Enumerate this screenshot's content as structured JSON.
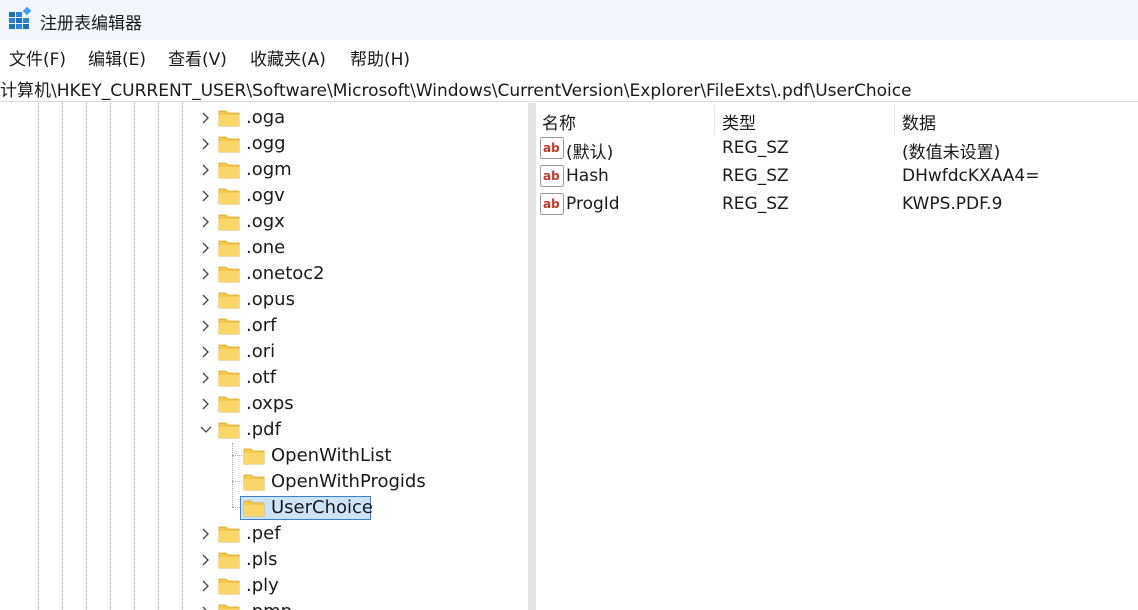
{
  "window": {
    "title": "注册表编辑器",
    "icon": "regedit-icon"
  },
  "menu": {
    "file": "文件(F)",
    "edit": "编辑(E)",
    "view": "查看(V)",
    "favorites": "收藏夹(A)",
    "help": "帮助(H)"
  },
  "address": {
    "path": "计算机\\HKEY_CURRENT_USER\\Software\\Microsoft\\Windows\\CurrentVersion\\Explorer\\FileExts\\.pdf\\UserChoice"
  },
  "tree": {
    "keys": [
      ".oga",
      ".ogg",
      ".ogm",
      ".ogv",
      ".ogx",
      ".one",
      ".onetoc2",
      ".opus",
      ".orf",
      ".ori",
      ".otf",
      ".oxps",
      ".pdf"
    ],
    "pdf_children": [
      "OpenWithList",
      "OpenWithProgids",
      "UserChoice"
    ],
    "selected": "UserChoice",
    "after_keys": [
      ".pef",
      ".pls",
      ".ply",
      ".pmp"
    ]
  },
  "values": {
    "headers": {
      "name": "名称",
      "type": "类型",
      "data": "数据"
    },
    "rows": [
      {
        "name": "(默认)",
        "type": "REG_SZ",
        "data": "(数值未设置)"
      },
      {
        "name": "Hash",
        "type": "REG_SZ",
        "data": "DHwfdcKXAA4="
      },
      {
        "name": "ProgId",
        "type": "REG_SZ",
        "data": "KWPS.PDF.9"
      }
    ]
  },
  "colors": {
    "folder": "#f8c94a",
    "selection_border": "#3b7fd4",
    "selection_fill": "#cce4f7",
    "ab_icon": "#c0392b"
  }
}
